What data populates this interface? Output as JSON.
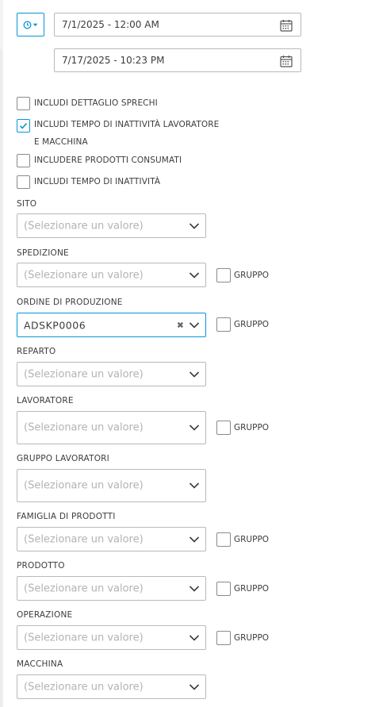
{
  "colors": {
    "accent": "#0696d7",
    "border": "#b9b9b9",
    "placeholder": "#b3b3b3"
  },
  "time_preset_button": {
    "icon": "clock-icon",
    "dropdown_icon": "caret-down-icon"
  },
  "date_range": {
    "start": "7/1/2025 - 12:00 AM",
    "end": "7/17/2025 - 10:23 PM",
    "icon": "calendar-icon"
  },
  "options": [
    {
      "label": "INCLUDI DETTAGLIO SPRECHI",
      "checked": false
    },
    {
      "label": "INCLUDI TEMPO DI INATTIVITÀ LAVORATORE E MACCHINA",
      "checked": true
    },
    {
      "label": "INCLUDERE PRODOTTI CONSUMATI",
      "checked": false
    },
    {
      "label": "INCLUDI TEMPO DI INATTIVITÀ",
      "checked": false
    }
  ],
  "placeholder": "(Selezionare un valore)",
  "group_label": "GRUPPO",
  "filters": [
    {
      "label": "SITO",
      "value": "",
      "group": false
    },
    {
      "label": "SPEDIZIONE",
      "value": "",
      "group": true,
      "group_checked": false
    },
    {
      "label": "ORDINE DI PRODUZIONE",
      "value": "ADSKP0006",
      "group": true,
      "group_checked": false,
      "clear_icon": "x-icon"
    },
    {
      "label": "REPARTO",
      "value": "",
      "group": false
    },
    {
      "label": "LAVORATORE",
      "value": "",
      "group": true,
      "group_checked": false
    },
    {
      "label": "GRUPPO LAVORATORI",
      "value": "",
      "group": false
    },
    {
      "label": "FAMIGLIA DI PRODOTTI",
      "value": "",
      "group": true,
      "group_checked": false
    },
    {
      "label": "PRODOTTO",
      "value": "",
      "group": true,
      "group_checked": false
    },
    {
      "label": "OPERAZIONE",
      "value": "",
      "group": true,
      "group_checked": false
    },
    {
      "label": "MACCHINA",
      "value": "",
      "group": false
    }
  ]
}
